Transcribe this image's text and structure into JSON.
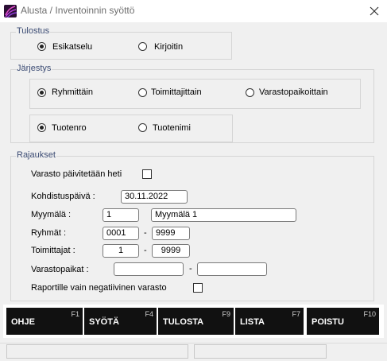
{
  "window": {
    "title": "Alusta / Inventoinnin syöttö"
  },
  "tulostus": {
    "legend": "Tulostus",
    "options": [
      "Esikatselu",
      "Kirjoitin"
    ],
    "selected": "Esikatselu"
  },
  "jarjestys": {
    "legend": "Järjestys",
    "group1": [
      "Ryhmittäin",
      "Toimittajittain",
      "Varastopaikoittain"
    ],
    "group1_selected": "Ryhmittäin",
    "group2": [
      "Tuotenro",
      "Tuotenimi"
    ],
    "group2_selected": "Tuotenro"
  },
  "rajaukset": {
    "legend": "Rajaukset",
    "varasto_label": "Varasto päivitetään heti",
    "varasto_checked": false,
    "kohdistus_label": "Kohdistuspäivä :",
    "kohdistus_value": "30.11.2022",
    "myymala_label": "Myymälä :",
    "myymala_value": "1",
    "myymala_name": "Myymälä 1",
    "ryhmat_label": "Ryhmät :",
    "ryhmat_from": "0001",
    "ryhmat_to": "9999",
    "toimittajat_label": "Toimittajat :",
    "toimittajat_from": "1",
    "toimittajat_to": "9999",
    "varastopaikat_label": "Varastopaikat :",
    "varastopaikat_from": "",
    "varastopaikat_to": "",
    "dash": "-",
    "negatiivinen_label": "Raportille vain negatiivinen varasto",
    "negatiivinen_checked": false
  },
  "buttons": [
    {
      "label": "OHJE",
      "key": "F1"
    },
    {
      "label": "SYÖTÄ",
      "key": "F4"
    },
    {
      "label": "TULOSTA",
      "key": "F9"
    },
    {
      "label": "LISTA",
      "key": "F7"
    },
    {
      "label": "POISTU",
      "key": "F10"
    }
  ],
  "status": [
    "",
    ""
  ]
}
